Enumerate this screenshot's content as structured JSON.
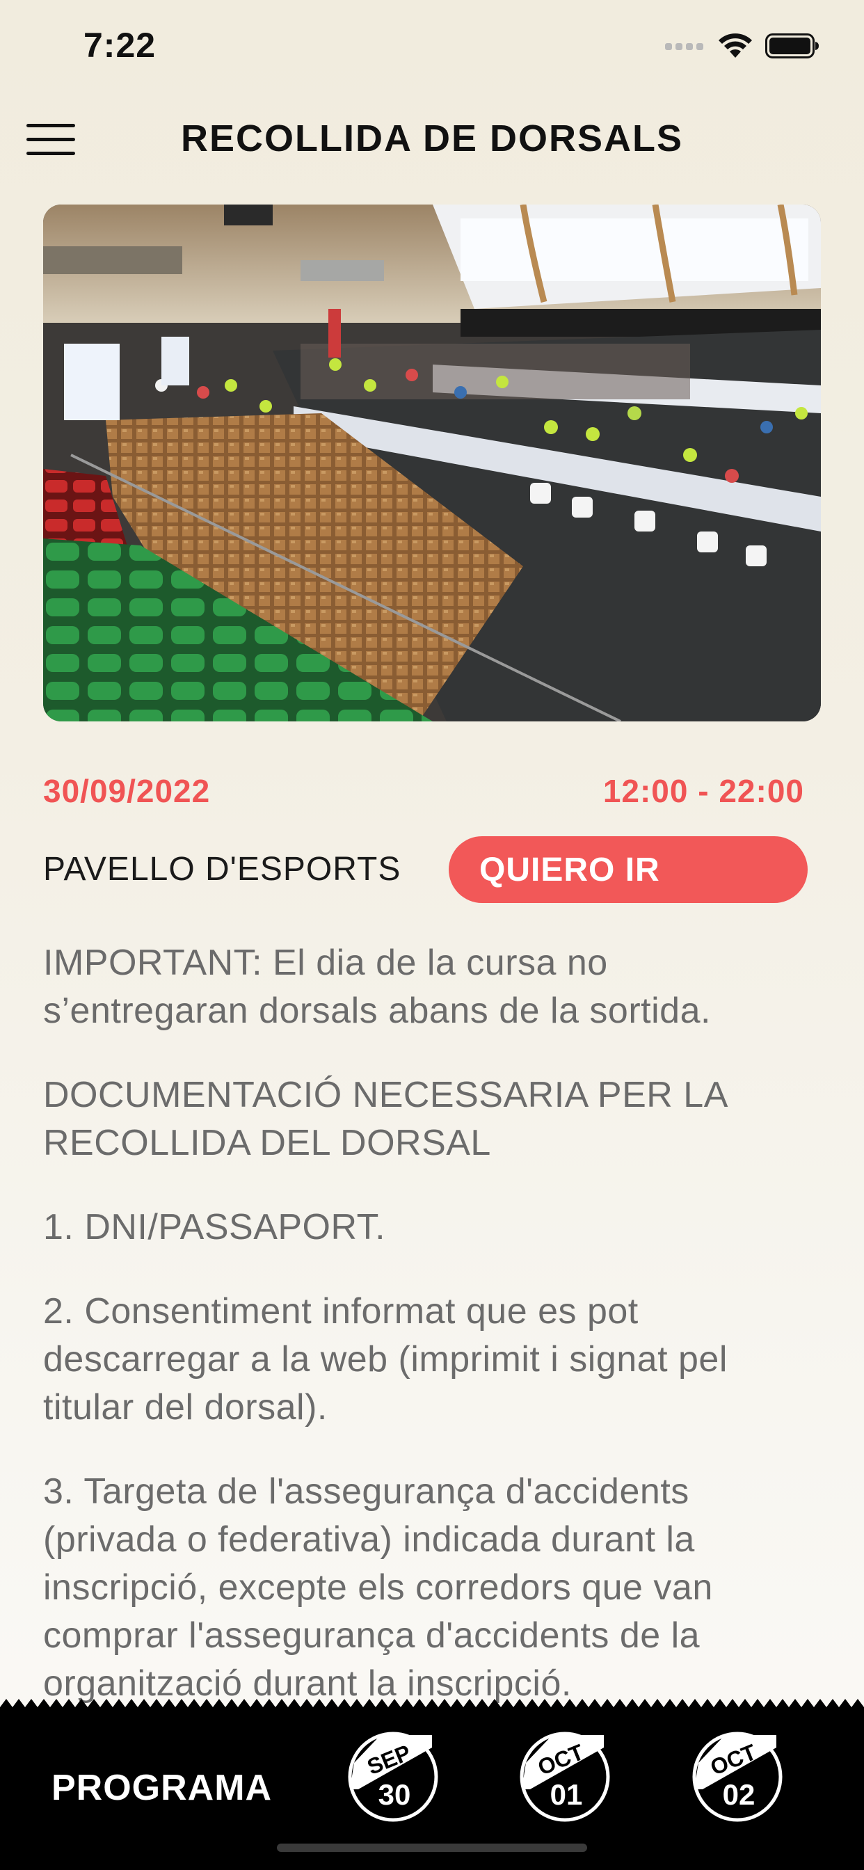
{
  "status_bar": {
    "time": "7:22"
  },
  "header": {
    "title": "RECOLLIDA DE DORSALS"
  },
  "event": {
    "date": "30/09/2022",
    "time": "12:00 - 22:00",
    "venue": "PAVELLO D'ESPORTS",
    "cta_label": "QUIERO IR"
  },
  "body": {
    "paragraphs": [
      "IMPORTANT: El dia de la cursa no s’entregaran dorsals abans de la sortida.",
      "DOCUMENTACIÓ NECESSARIA PER LA RECOLLIDA DEL DORSAL",
      "1. DNI/PASSAPORT.",
      "2. Consentiment informat que es pot descarregar a la web (imprimit i signat pel titular del dorsal).",
      "3. Targeta de l'assegurança d'accidents (privada o federativa) indicada durant la inscripció, excepte els corredors que van comprar l'assegurança d'accidents de la organització durant la inscripció."
    ]
  },
  "tabbar": {
    "programa_label": "PROGRAMA",
    "days": [
      {
        "month": "SEP",
        "day": "30"
      },
      {
        "month": "OCT",
        "day": "01"
      },
      {
        "month": "OCT",
        "day": "02"
      }
    ]
  },
  "colors": {
    "accent": "#f25858",
    "background": "#f1ecde",
    "tabbar": "#000000"
  }
}
